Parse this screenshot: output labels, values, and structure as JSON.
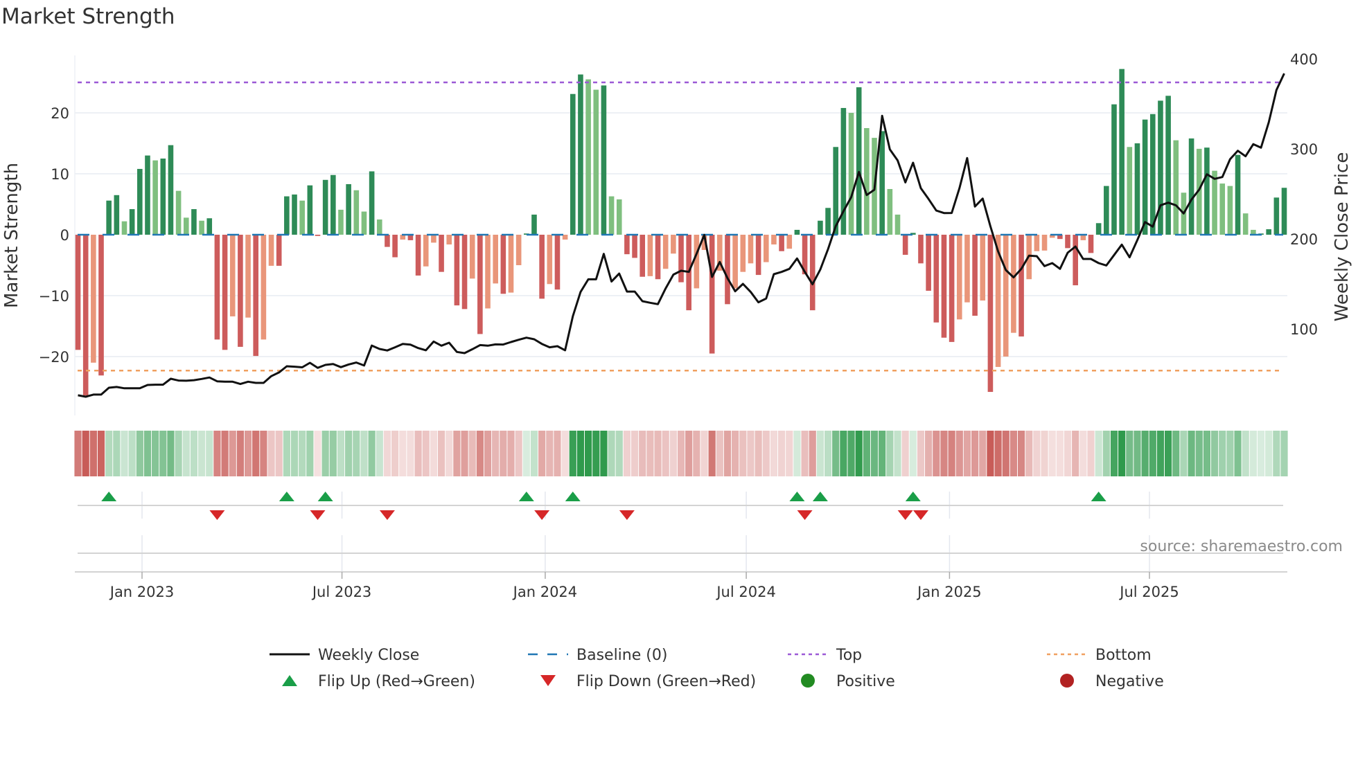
{
  "chart_data": {
    "type": "bar",
    "title": "Market Strength",
    "ylabel": "Market Strength",
    "y2label": "Weekly Close Price",
    "ylim": [
      -27,
      29
    ],
    "y2lim": [
      20,
      415
    ],
    "yticks": [
      "20",
      "10",
      "0",
      "−10",
      "−20"
    ],
    "ytick_values": [
      20,
      10,
      0,
      -10,
      -20
    ],
    "y2ticks": [
      "400",
      "300",
      "200",
      "100"
    ],
    "y2tick_values": [
      400,
      300,
      200,
      100
    ],
    "xticks": [
      {
        "label": "Jan 2023",
        "date": "2023-01-01"
      },
      {
        "label": "Jul 2023",
        "date": "2023-07-01"
      },
      {
        "label": "Jan 2024",
        "date": "2024-01-01"
      },
      {
        "label": "Jul 2024",
        "date": "2024-07-01"
      },
      {
        "label": "Jan 2025",
        "date": "2025-01-01"
      },
      {
        "label": "Jul 2025",
        "date": "2025-07-01"
      }
    ],
    "grid": true,
    "legend_position": "bottom",
    "top_level": 25,
    "bottom_level": -22.3,
    "dates": [
      "2022-11-04",
      "2022-11-11",
      "2022-11-18",
      "2022-11-25",
      "2022-12-02",
      "2022-12-09",
      "2022-12-16",
      "2022-12-23",
      "2022-12-30",
      "2023-01-06",
      "2023-01-13",
      "2023-01-20",
      "2023-01-27",
      "2023-02-03",
      "2023-02-10",
      "2023-02-17",
      "2023-02-24",
      "2023-03-03",
      "2023-03-10",
      "2023-03-17",
      "2023-03-24",
      "2023-03-31",
      "2023-04-07",
      "2023-04-14",
      "2023-04-21",
      "2023-04-28",
      "2023-05-05",
      "2023-05-12",
      "2023-05-19",
      "2023-05-26",
      "2023-06-02",
      "2023-06-09",
      "2023-06-16",
      "2023-06-23",
      "2023-06-30",
      "2023-07-07",
      "2023-07-14",
      "2023-07-21",
      "2023-07-28",
      "2023-08-04",
      "2023-08-11",
      "2023-08-18",
      "2023-08-25",
      "2023-09-01",
      "2023-09-08",
      "2023-09-15",
      "2023-09-22",
      "2023-09-29",
      "2023-10-06",
      "2023-10-13",
      "2023-10-20",
      "2023-10-27",
      "2023-11-03",
      "2023-11-10",
      "2023-11-17",
      "2023-11-24",
      "2023-12-01",
      "2023-12-08",
      "2023-12-15",
      "2023-12-22",
      "2023-12-29",
      "2024-01-05",
      "2024-01-12",
      "2024-01-19",
      "2024-01-26",
      "2024-02-02",
      "2024-02-09",
      "2024-02-16",
      "2024-02-23",
      "2024-03-01",
      "2024-03-08",
      "2024-03-15",
      "2024-03-22",
      "2024-03-29",
      "2024-04-05",
      "2024-04-12",
      "2024-04-19",
      "2024-04-26",
      "2024-05-03",
      "2024-05-10",
      "2024-05-17",
      "2024-05-24",
      "2024-05-31",
      "2024-06-07",
      "2024-06-14",
      "2024-06-21",
      "2024-06-28",
      "2024-07-05",
      "2024-07-12",
      "2024-07-19",
      "2024-07-26",
      "2024-08-02",
      "2024-08-09",
      "2024-08-16",
      "2024-08-23",
      "2024-08-30",
      "2024-09-06",
      "2024-09-13",
      "2024-09-20",
      "2024-09-27",
      "2024-10-04",
      "2024-10-11",
      "2024-10-18",
      "2024-10-25",
      "2024-11-01",
      "2024-11-08",
      "2024-11-15",
      "2024-11-22",
      "2024-11-29",
      "2024-12-06",
      "2024-12-13",
      "2024-12-20",
      "2024-12-27",
      "2025-01-03",
      "2025-01-10",
      "2025-01-17",
      "2025-01-24",
      "2025-01-31",
      "2025-02-07",
      "2025-02-14",
      "2025-02-21",
      "2025-02-28",
      "2025-03-07",
      "2025-03-14",
      "2025-03-21",
      "2025-03-28",
      "2025-04-04",
      "2025-04-11",
      "2025-04-18",
      "2025-04-25",
      "2025-05-02",
      "2025-05-09",
      "2025-05-16",
      "2025-05-23",
      "2025-05-30",
      "2025-06-06",
      "2025-06-13",
      "2025-06-20",
      "2025-06-27",
      "2025-07-04",
      "2025-07-11",
      "2025-07-18",
      "2025-07-25",
      "2025-08-01",
      "2025-08-08",
      "2025-08-15",
      "2025-08-22",
      "2025-08-29",
      "2025-09-05",
      "2025-09-12",
      "2025-09-19",
      "2025-09-26",
      "2025-10-03",
      "2025-10-10",
      "2025-10-17",
      "2025-10-24",
      "2025-10-31"
    ],
    "strength": [
      -18.9,
      -26.4,
      -21,
      -23.1,
      5.6,
      6.5,
      2.2,
      4.2,
      10.8,
      13,
      12.2,
      12.5,
      14.7,
      7.2,
      2.8,
      4.2,
      2.3,
      2.7,
      -17.2,
      -18.9,
      -13.4,
      -18.4,
      -13.6,
      -19.9,
      -17.2,
      -5.1,
      -5.1,
      6.3,
      6.6,
      5.6,
      8.1,
      -0.2,
      9.0,
      9.8,
      4.1,
      8.3,
      7.3,
      3.8,
      10.4,
      2.5,
      -2,
      -3.7,
      -0.8,
      -0.9,
      -6.7,
      -5.2,
      -1.3,
      -6.1,
      -1.6,
      -11.6,
      -12.2,
      -7.2,
      -16.3,
      -12.1,
      -8,
      -9.7,
      -9.5,
      -5,
      0.2,
      3.3,
      -10.5,
      -8.1,
      -9,
      -0.8,
      23.1,
      26.3,
      25.5,
      23.8,
      24.5,
      6.3,
      5.8,
      -3.2,
      -3.8,
      -6.9,
      -6.8,
      -7.3,
      -5.6,
      -3.1,
      -7.8,
      -12.4,
      -8.8,
      -2.5,
      -19.5,
      -5.9,
      -11.4,
      -8.8,
      -6.1,
      -4.7,
      -6.6,
      -4.5,
      -1.6,
      -2.7,
      -2.3,
      0.8,
      -6.5,
      -12.4,
      2.3,
      4.4,
      14.4,
      20.8,
      20,
      24.2,
      17.5,
      15.9,
      17,
      7.5,
      3.3,
      -3.3,
      0.3,
      -4.7,
      -9.2,
      -14.4,
      -16.9,
      -17.6,
      -13.9,
      -11.1,
      -13.3,
      -10.8,
      -25.8,
      -21.7,
      -20,
      -16.1,
      -16.7,
      -7.3,
      -2.7,
      -2.6,
      -0.5,
      -0.7,
      -2.2,
      -8.3,
      -0.9,
      -3,
      1.9,
      8,
      21.4,
      27.2,
      14.4,
      15,
      18.9,
      19.8,
      22,
      22.8,
      15.5,
      6.9,
      15.8,
      14.1,
      14.3,
      10.5,
      8.4,
      8,
      13.1,
      3.5,
      0.8,
      0.2,
      0.9,
      6.1,
      7.7
    ],
    "shades": "RRrRGGgGGGgGGggGgGRRrRrRrrRGGgGRGGgGggGgRRrRRrrRrRRrRrrRrrGGRrRrGGggGggRRRrRrrRRrrRrRrrrRrrRrGRRGGGGgGggGggRGRRRRRrrRrRrrrRrrrrRRRrRGGGGgGGGGGggGgGgggGggGGGG",
    "weekly_close": [
      26.2,
      24.6,
      27,
      27,
      34.6,
      35.5,
      34,
      34,
      34,
      37.7,
      38,
      38,
      44.6,
      42.6,
      42.4,
      43,
      44.4,
      46,
      41.8,
      41.3,
      41.3,
      38.8,
      41.3,
      40,
      40,
      47.5,
      51.6,
      58.5,
      58,
      57.3,
      62.3,
      56.7,
      60,
      61,
      57.5,
      60.5,
      62.6,
      59.3,
      81.5,
      77.7,
      76,
      79.5,
      83.3,
      82.5,
      78.7,
      76.2,
      85.9,
      81.3,
      84.6,
      74.4,
      73.1,
      77.4,
      82,
      81.3,
      82.8,
      82.6,
      85.4,
      87.9,
      90.2,
      88.5,
      83.3,
      79.5,
      80.8,
      76.2,
      114.1,
      141,
      155.1,
      155.1,
      183.3,
      152.6,
      161.5,
      141.5,
      141.5,
      130.8,
      129,
      127.5,
      144.9,
      160.3,
      164.6,
      163.3,
      183.3,
      204.4,
      157.7,
      174.4,
      156.4,
      141.8,
      150,
      141,
      129.5,
      133.8,
      160.8,
      163.3,
      166.7,
      178.2,
      163.3,
      149.5,
      165.9,
      188.5,
      214.1,
      230.8,
      246.2,
      274.4,
      248.7,
      254.6,
      336.7,
      299.5,
      287.2,
      262.8,
      284.6,
      256.4,
      244.4,
      231.5,
      228.7,
      228.8,
      256.4,
      289.8,
      235.9,
      244.8,
      214.1,
      186,
      165.4,
      157.2,
      166.7,
      181.3,
      180.8,
      169.8,
      173.1,
      166.7,
      184.6,
      191.5,
      177.7,
      177.7,
      173.1,
      170.5,
      182.1,
      193.6,
      179.5,
      198.7,
      218.7,
      213.6,
      237.2,
      240.2,
      237.2,
      228.2,
      243.6,
      254.6,
      271.8,
      266.7,
      268.7,
      288.5,
      297.9,
      291.8,
      305.2,
      301.3,
      329.5,
      365.4,
      383.8
    ],
    "flip_up": [
      "2022-12-02",
      "2023-05-12",
      "2023-06-16",
      "2023-12-15",
      "2024-01-26",
      "2024-08-16",
      "2024-09-06",
      "2024-11-29",
      "2025-05-16"
    ],
    "flip_down": [
      "2023-03-10",
      "2023-06-09",
      "2023-08-11",
      "2023-12-29",
      "2024-03-15",
      "2024-08-23",
      "2024-11-22",
      "2024-12-06"
    ],
    "source": "source: sharemaestro.com",
    "legend": [
      {
        "label": "Weekly Close",
        "kind": "line",
        "color": "#111111"
      },
      {
        "label": "Baseline (0)",
        "kind": "dash",
        "color": "#1f77b4"
      },
      {
        "label": "Top",
        "kind": "dot",
        "color": "#9b59d6"
      },
      {
        "label": "Bottom",
        "kind": "dot",
        "color": "#f0a060"
      },
      {
        "label": "Flip Up (Red→Green)",
        "kind": "tri-up",
        "color": "#1a9e48"
      },
      {
        "label": "Flip Down (Green→Red)",
        "kind": "tri-down",
        "color": "#d62728"
      },
      {
        "label": "Positive",
        "kind": "circle",
        "color": "#228b22"
      },
      {
        "label": "Negative",
        "kind": "circle",
        "color": "#b22222"
      }
    ],
    "colors": {
      "strong_positive": "#2e8b57",
      "weak_positive": "#7fbf7f",
      "strong_negative": "#cd5c5c",
      "weak_negative": "#e9967a",
      "baseline": "#1f77b4",
      "top": "#9b59d6",
      "bottom": "#f0a060",
      "close_line": "#111111"
    }
  }
}
